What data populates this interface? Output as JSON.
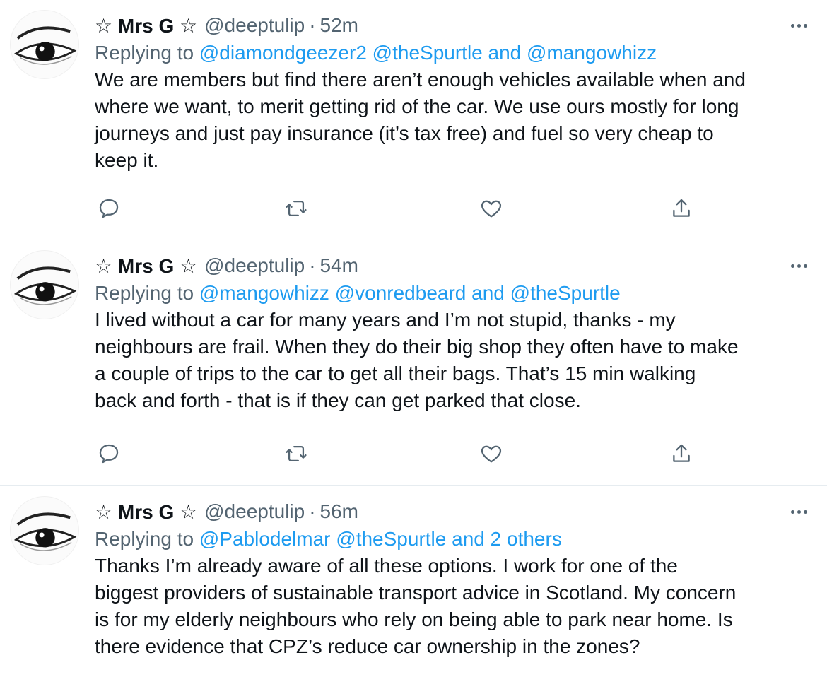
{
  "tweets": [
    {
      "name": "☆ Mrs G ☆",
      "handle": "@deeptulip",
      "dot": "·",
      "time": "52m",
      "replying_prefix": "Replying to",
      "replying": [
        {
          "text": "@diamondgeezer2",
          "sep": " "
        },
        {
          "text": "@theSpurtle",
          "sep": " and "
        },
        {
          "text": "@mangowhizz",
          "sep": ""
        }
      ],
      "lines": [
        "We are members but find there aren’t enough vehicles available when and",
        "where we want, to merit getting rid of the car. We use ours mostly for long",
        "journeys and just pay insurance (it’s tax free) and fuel so very cheap to",
        "keep it."
      ]
    },
    {
      "name": "☆ Mrs G ☆",
      "handle": "@deeptulip",
      "dot": "·",
      "time": "54m",
      "replying_prefix": "Replying to",
      "replying": [
        {
          "text": "@mangowhizz",
          "sep": " "
        },
        {
          "text": "@vonredbeard",
          "sep": " and "
        },
        {
          "text": "@theSpurtle",
          "sep": ""
        }
      ],
      "lines": [
        "I lived without a car for many years and I’m not stupid, thanks - my",
        "neighbours are frail. When they do their big shop they often have to make",
        "a couple of trips to the car to get all their bags. That’s 15 min walking",
        "back and forth - that is if they can get parked that close."
      ]
    },
    {
      "name": "☆ Mrs G ☆",
      "handle": "@deeptulip",
      "dot": "·",
      "time": "56m",
      "replying_prefix": "Replying to",
      "replying": [
        {
          "text": "@Pablodelmar",
          "sep": " "
        },
        {
          "text": "@theSpurtle",
          "sep": " and "
        },
        {
          "text": "2 others",
          "sep": ""
        }
      ],
      "lines": [
        "Thanks I’m already aware of all these options. I work for one of the",
        "biggest providers of sustainable transport advice in Scotland. My concern",
        "is for my elderly neighbours who rely on being able to park near home. Is",
        "there evidence that CPZ’s reduce car ownership in the zones?"
      ]
    }
  ],
  "icons": {
    "reply": "reply-icon",
    "retweet": "retweet-icon",
    "like": "like-icon",
    "share": "share-icon",
    "more": "more-icon",
    "avatar": "eye-avatar"
  },
  "colors": {
    "text": "#0f1419",
    "muted": "#536471",
    "link": "#1d9bf0",
    "divider": "#e6ecf0"
  }
}
